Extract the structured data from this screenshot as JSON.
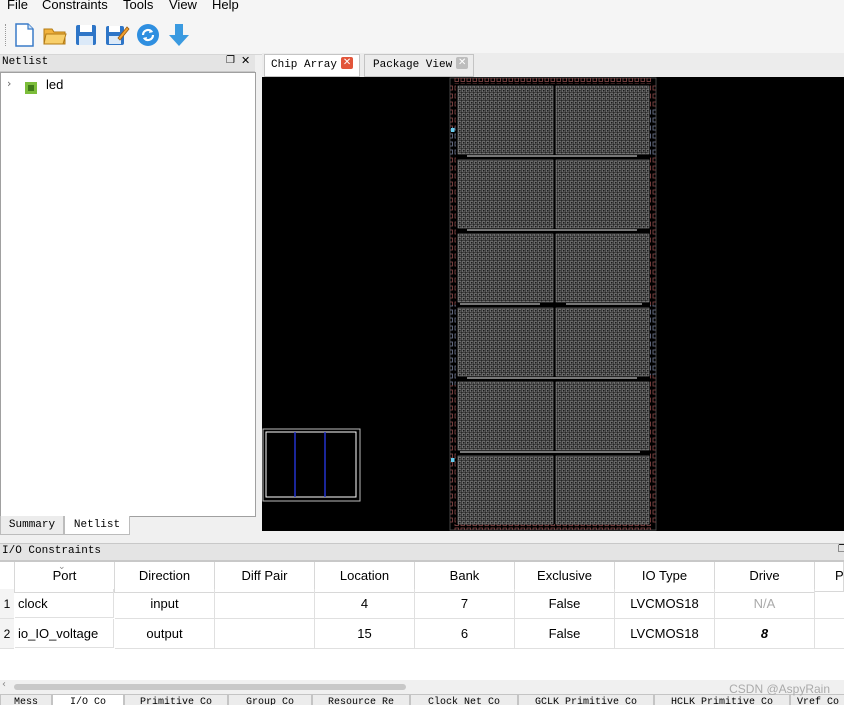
{
  "menu": [
    "File",
    "Constraints",
    "Tools",
    "View",
    "Help"
  ],
  "toolbar": {
    "buttons": [
      "new-file-icon",
      "open-folder-icon",
      "save-icon",
      "save-as-icon",
      "refresh-icon",
      "download-icon"
    ]
  },
  "netlist": {
    "title": "Netlist",
    "tree": [
      {
        "label": "led",
        "expanded": false
      }
    ]
  },
  "left_tabs": [
    "Summary",
    "Netlist"
  ],
  "view_tabs": [
    {
      "label": "Chip Array",
      "active": true
    },
    {
      "label": "Package View",
      "active": false
    }
  ],
  "io_constraints": {
    "title": "I/O Constraints",
    "columns": [
      "Port",
      "Direction",
      "Diff Pair",
      "Location",
      "Bank",
      "Exclusive",
      "IO Type",
      "Drive",
      "Pu"
    ],
    "rows": [
      {
        "num": "1",
        "port": "clock",
        "direction": "input",
        "diff_pair": "",
        "location": "4",
        "bank": "7",
        "exclusive": "False",
        "io_type": "LVCMOS18",
        "drive": "N/A",
        "pull": ""
      },
      {
        "num": "2",
        "port": "io_IO_voltage",
        "direction": "output",
        "diff_pair": "",
        "location": "15",
        "bank": "6",
        "exclusive": "False",
        "io_type": "LVCMOS18",
        "drive": "8",
        "pull": ""
      }
    ]
  },
  "bottom_tabs": [
    "Mess",
    "I/O Co",
    "Primitive Co",
    "Group Co",
    "Resource Re",
    "Clock Net Co",
    "GCLK Primitive Co",
    "HCLK Primitive Co",
    "Vref Co"
  ],
  "watermark": "CSDN @AspyRain",
  "colors": {
    "accent_close": "#e2553a",
    "chip_bg": "#000000",
    "minimap_blue": "#2233cc"
  }
}
